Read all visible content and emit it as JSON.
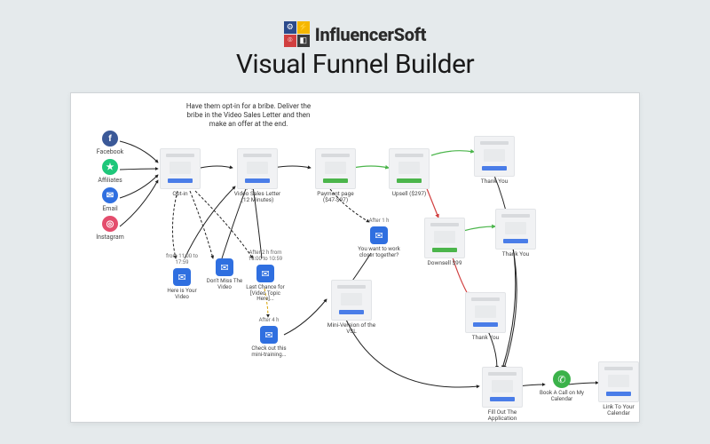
{
  "brand": {
    "name": "InfluencerSoft"
  },
  "title": "Visual Funnel Builder",
  "description": "Have them opt-in for a bribe. Deliver the bribe in the Video Sales Letter and then make an offer at the end.",
  "sources": {
    "facebook": {
      "label": "Facebook",
      "glyph": "f"
    },
    "affiliates": {
      "label": "Affiliates",
      "glyph": "★"
    },
    "email": {
      "label": "Email",
      "glyph": "✉"
    },
    "instagram": {
      "label": "Instagram",
      "glyph": "◎"
    }
  },
  "pages": {
    "optin": {
      "label": "Opt-in"
    },
    "vsl": {
      "label": "Video Sales Letter (12 Minutes)"
    },
    "payment": {
      "label": "Payment page ($47-$97)"
    },
    "upsell": {
      "label": "Upsell ($297)"
    },
    "thankyou1": {
      "label": "Thank You"
    },
    "thankyou2": {
      "label": "Thank You"
    },
    "downsell": {
      "label": "Downsell $99"
    },
    "minivsl": {
      "label": "Mini-Version of the VSL"
    },
    "thankyou3": {
      "label": "Thank You"
    },
    "fillapp": {
      "label": "Fill Out The Application"
    },
    "linkcal": {
      "label": "Link To Your Calendar"
    }
  },
  "emails": {
    "e1": {
      "top": "from 11:00 to 17:59",
      "label": "Here is Your Video"
    },
    "e2": {
      "top": "",
      "label": "Don't Miss The Video"
    },
    "e3": {
      "top": "After 2 h from 18:00 to 10:59",
      "label": "Last Chance for [Video Topic Here]..."
    },
    "e4": {
      "top": "After 4 h",
      "label": "Check out this mini-training..."
    },
    "e5": {
      "top": "After 1 h",
      "label": "You want to work closer together?"
    }
  },
  "call": {
    "label": "Book A Call on My Calendar"
  },
  "icons": {
    "envelope": "✉",
    "phone": "✆"
  },
  "colors": {
    "blue": "#2f6fe0",
    "green": "#4bb54b",
    "red": "#d13f3f",
    "black": "#222"
  }
}
